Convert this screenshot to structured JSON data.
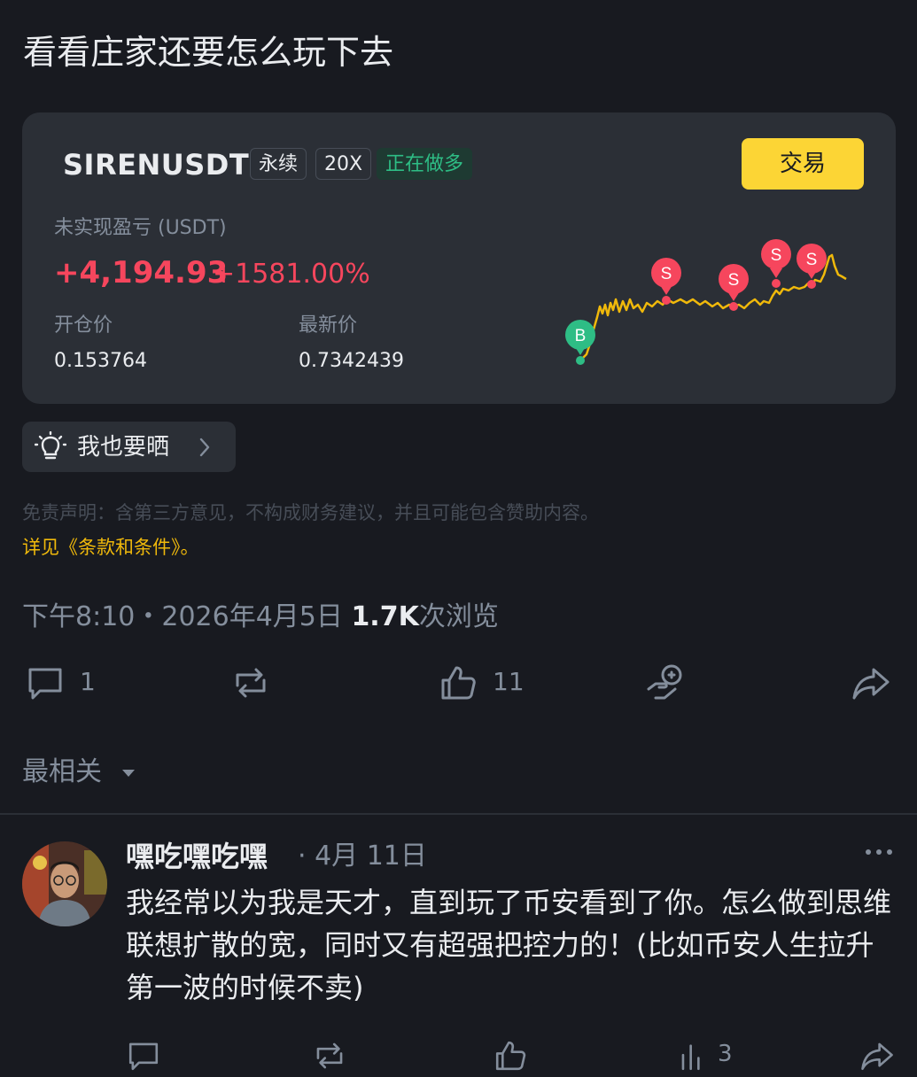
{
  "post": {
    "title": "看看庄家还要怎么玩下去",
    "timestamp": "下午8:10・2026年4月5日",
    "views": "1.7K",
    "views_suffix": "次浏览"
  },
  "position_card": {
    "symbol": "SIRENUSDT",
    "tags": [
      "永续",
      "20X",
      "正在做多"
    ],
    "trade_label": "交易",
    "pnl_label": "未实现盈亏 (USDT)",
    "pnl_value": "+4,194.93",
    "pnl_percent": "+1581.00%",
    "open_label": "开仓价",
    "open_value": "0.153764",
    "last_label": "最新价",
    "last_value": "0.7342439",
    "markers": {
      "buy": "B",
      "sell": "S"
    },
    "colors": {
      "line": "#f0b90b",
      "sell": "#f6465d",
      "buy": "#2ebd85"
    }
  },
  "share": {
    "label": "我也要晒",
    "icon": "lightbulb-icon"
  },
  "disclaimer": {
    "text": "免责声明：含第三方意见，不构成财务建议，并且可能包含赞助内容。",
    "terms": "详见《条款和条件》。"
  },
  "actions": {
    "comments": "1",
    "likes": "11",
    "icons": [
      "comment-icon",
      "repost-icon",
      "like-icon",
      "tip-icon",
      "share-icon"
    ]
  },
  "sort": {
    "label": "最相关"
  },
  "comment": {
    "author": "嘿吃嘿吃嘿",
    "date": "· 4月 11日",
    "text": "我经常以为我是天才，直到玩了币安看到了你。怎么做到思维联想扩散的宽，同时又有超强把控力的！(比如币安人生拉升第一波的时候不卖)",
    "views": "3"
  }
}
